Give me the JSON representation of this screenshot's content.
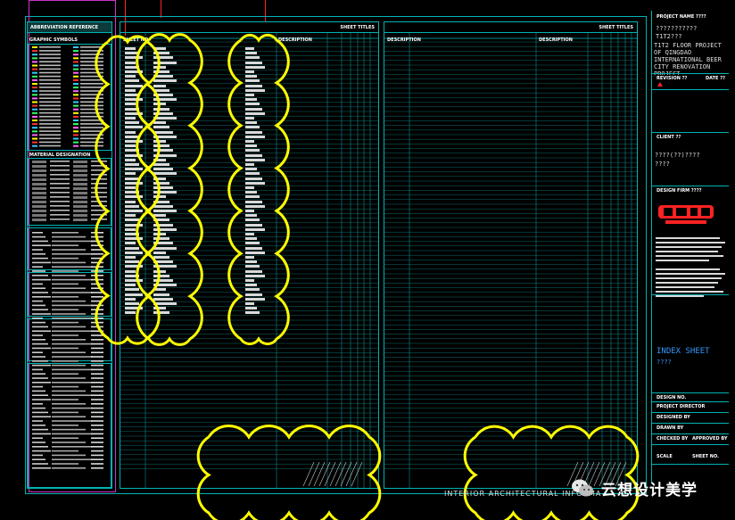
{
  "abbrev_header": "ABBREVIATION REFERENCE",
  "graphic_symbols_label": "GRAPHIC SYMBOLS",
  "material_label": "MATERIAL DESIGNATION",
  "sheet_titles_left": "SHEET TITLES",
  "sheet_titles_right": "SHEET TITLES",
  "col_headers": {
    "sheet_no": "SHEET NO.",
    "description": "DESCRIPTION",
    "col3": "DESCRIPTION",
    "col4": "DESCRIPTION",
    "col5": "DESCRIPTION"
  },
  "title_block": {
    "project_name_label": "PROJECT NAME ????",
    "project_q1": "???????????",
    "project_q2": "T1T2???",
    "project_en": [
      "T1T2 FLOOR PROJECT",
      "OF QINGDAO",
      "INTERNATIONAL BEER",
      "CITY RENOVATION",
      "PROJECT"
    ],
    "revision_label": "REVISION ??",
    "date_label": "DATE ??",
    "client_label": "CLIENT ??",
    "client_q1": "????(??)????",
    "client_q2": "????",
    "design_firm_label": "DESIGN FIRM ????",
    "sheet_title": "INDEX SHEET",
    "sheet_title_q": "????",
    "design_no_label": "DESIGN NO.",
    "project_director_label": "PROJECT DIRECTOR",
    "designed_by_label": "DESIGNED BY",
    "drawn_by_label": "DRAWN BY",
    "checked_by_label": "CHECKED BY",
    "approved_by_label": "APPROVED BY",
    "scale_label": "SCALE",
    "sheet_no_label": "SHEET NO."
  },
  "footer_text": "INTERIOR ARCHITECTURAL INFORMA",
  "watermark": "云想设计美学",
  "colors": {
    "frame": "#00b3b3",
    "cloud": "#ffff00",
    "magenta": "#cc33cc",
    "red": "#ff2222",
    "blue_text": "#3399ff"
  }
}
